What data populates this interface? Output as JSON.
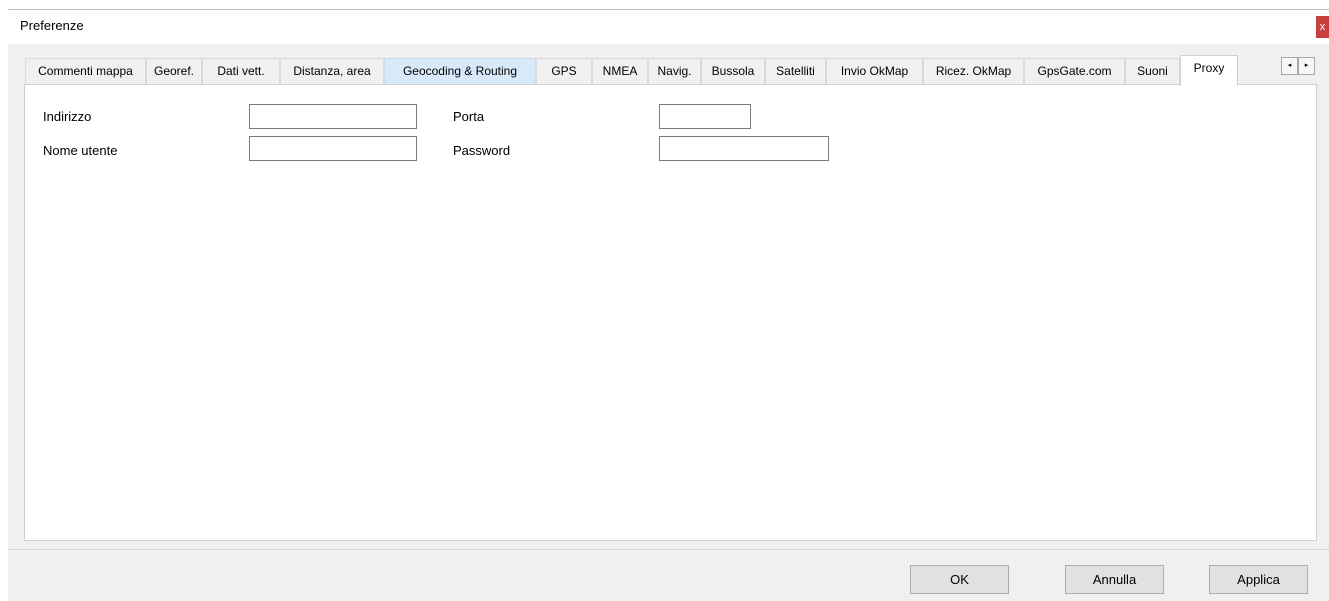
{
  "window": {
    "title": "Preferenze",
    "close_glyph": "x"
  },
  "tabs": [
    {
      "label": "Commenti mappa"
    },
    {
      "label": "Georef."
    },
    {
      "label": "Dati vett."
    },
    {
      "label": "Distanza, area"
    },
    {
      "label": "Geocoding & Routing"
    },
    {
      "label": "GPS"
    },
    {
      "label": "NMEA"
    },
    {
      "label": "Navig."
    },
    {
      "label": "Bussola"
    },
    {
      "label": "Satelliti"
    },
    {
      "label": "Invio OkMap"
    },
    {
      "label": "Ricez. OkMap"
    },
    {
      "label": "GpsGate.com"
    },
    {
      "label": "Suoni"
    },
    {
      "label": "Proxy"
    }
  ],
  "active_tab": "Proxy",
  "hovered_tab": "Geocoding & Routing",
  "tab_scroller": {
    "left_icon": "arrow-left-icon",
    "right_icon": "arrow-right-icon",
    "left_glyph": "◂",
    "right_glyph": "▸"
  },
  "proxy": {
    "address_label": "Indirizzo",
    "address_value": "",
    "port_label": "Porta",
    "port_value": "",
    "username_label": "Nome utente",
    "username_value": "",
    "password_label": "Password",
    "password_value": ""
  },
  "buttons": {
    "ok": "OK",
    "cancel": "Annulla",
    "apply": "Applica"
  },
  "colors": {
    "close_red": "#c8403c",
    "tab_hover": "#d8eaf9",
    "dialog_bg": "#f0f0f0"
  }
}
